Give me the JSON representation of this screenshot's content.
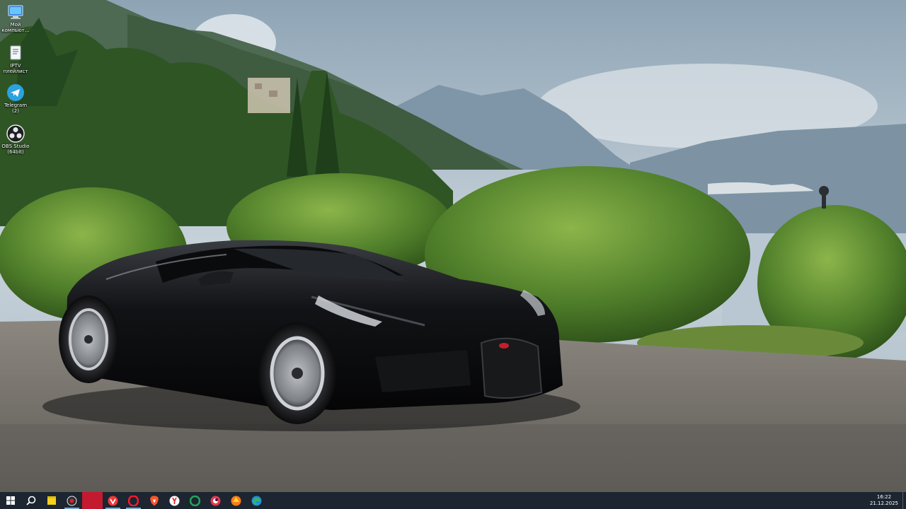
{
  "desktop": {
    "icons": [
      {
        "label": "Мой\nкомпьют...",
        "icon": "my-computer-icon"
      },
      {
        "label": "IPTV\nплейлист",
        "icon": "iptv-playlist-icon"
      },
      {
        "label": "Telegram (2)",
        "icon": "telegram-icon"
      },
      {
        "label": "OBS Studio\n(64bit)",
        "icon": "obs-studio-icon"
      }
    ]
  },
  "taskbar": {
    "apps": [
      {
        "icon": "windows-start-icon"
      },
      {
        "icon": "search-icon"
      },
      {
        "icon": "sticky-notes-icon",
        "color": "#f2d21b"
      },
      {
        "icon": "screen-recorder-icon",
        "color": "#d9202c"
      },
      {
        "icon": "active-app-icon",
        "color": "#c41a30"
      },
      {
        "icon": "vivaldi-icon",
        "color": "#ef3939"
      },
      {
        "icon": "opera-icon",
        "color": "#ff1b2d"
      },
      {
        "icon": "brave-icon",
        "color": "#fb542b"
      },
      {
        "icon": "yandex-browser-icon",
        "color": "#ffffff"
      },
      {
        "icon": "app-green-icon",
        "color": "#23a55a"
      },
      {
        "icon": "app-red-icon",
        "color": "#e8384f"
      },
      {
        "icon": "app-orange-icon",
        "color": "#ff7a1a"
      },
      {
        "icon": "edge-icon",
        "color": "#3ab06f"
      }
    ],
    "clock": {
      "time": "16:22",
      "date": "21.12.2025"
    }
  }
}
